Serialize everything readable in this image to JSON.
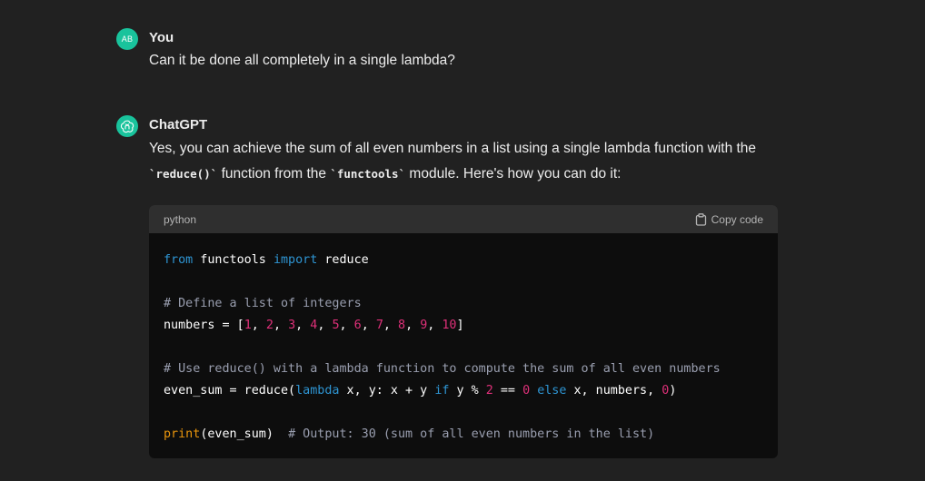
{
  "conversation": {
    "user": {
      "avatar_initials": "AB",
      "author": "You",
      "message": "Can it be done all completely in a single lambda?"
    },
    "assistant": {
      "author": "ChatGPT",
      "line1": "Yes, you can achieve the sum of all even numbers in a list using a single lambda function with the",
      "line2_code1": "`reduce()`",
      "line2_text1": " function from the ",
      "line2_code2": "`functools`",
      "line2_text2": " module. Here's how you can do it:"
    }
  },
  "code_block": {
    "language": "python",
    "copy_label": "Copy code",
    "lines": {
      "l1_kw1": "from",
      "l1_t1": " functools ",
      "l1_kw2": "import",
      "l1_t2": " reduce",
      "l3_comment": "# Define a list of integers",
      "l4_t1": "numbers = [",
      "n1": "1",
      "n2": "2",
      "n3": "3",
      "n4": "4",
      "n5": "5",
      "n6": "6",
      "n7": "7",
      "n8": "8",
      "n9": "9",
      "n10": "10",
      "sep": ", ",
      "l4_close": "]",
      "l6_comment": "# Use reduce() with a lambda function to compute the sum of all even numbers",
      "l7_t1": "even_sum = reduce(",
      "l7_kw1": "lambda",
      "l7_t2": " x, y: x + y ",
      "l7_kw2": "if",
      "l7_t3": " y % ",
      "l7_n1": "2",
      "l7_t4": " == ",
      "l7_n2": "0",
      "l7_t5": " ",
      "l7_kw3": "else",
      "l7_t6": " x, numbers, ",
      "l7_n3": "0",
      "l7_close": ")",
      "l9_fn": "print",
      "l9_t1": "(even_sum)  ",
      "l9_comment": "# Output: 30 (sum of all even numbers in the list)"
    }
  },
  "colors": {
    "background": "#212121",
    "avatar": "#19c39c",
    "code_bg": "#0d0d0d",
    "code_header_bg": "#2f2f2f",
    "keyword": "#2e95d3",
    "number": "#df3079",
    "function": "#e9950c"
  },
  "icons": {
    "assistant_avatar": "openai-logo-icon",
    "copy": "clipboard-icon"
  }
}
